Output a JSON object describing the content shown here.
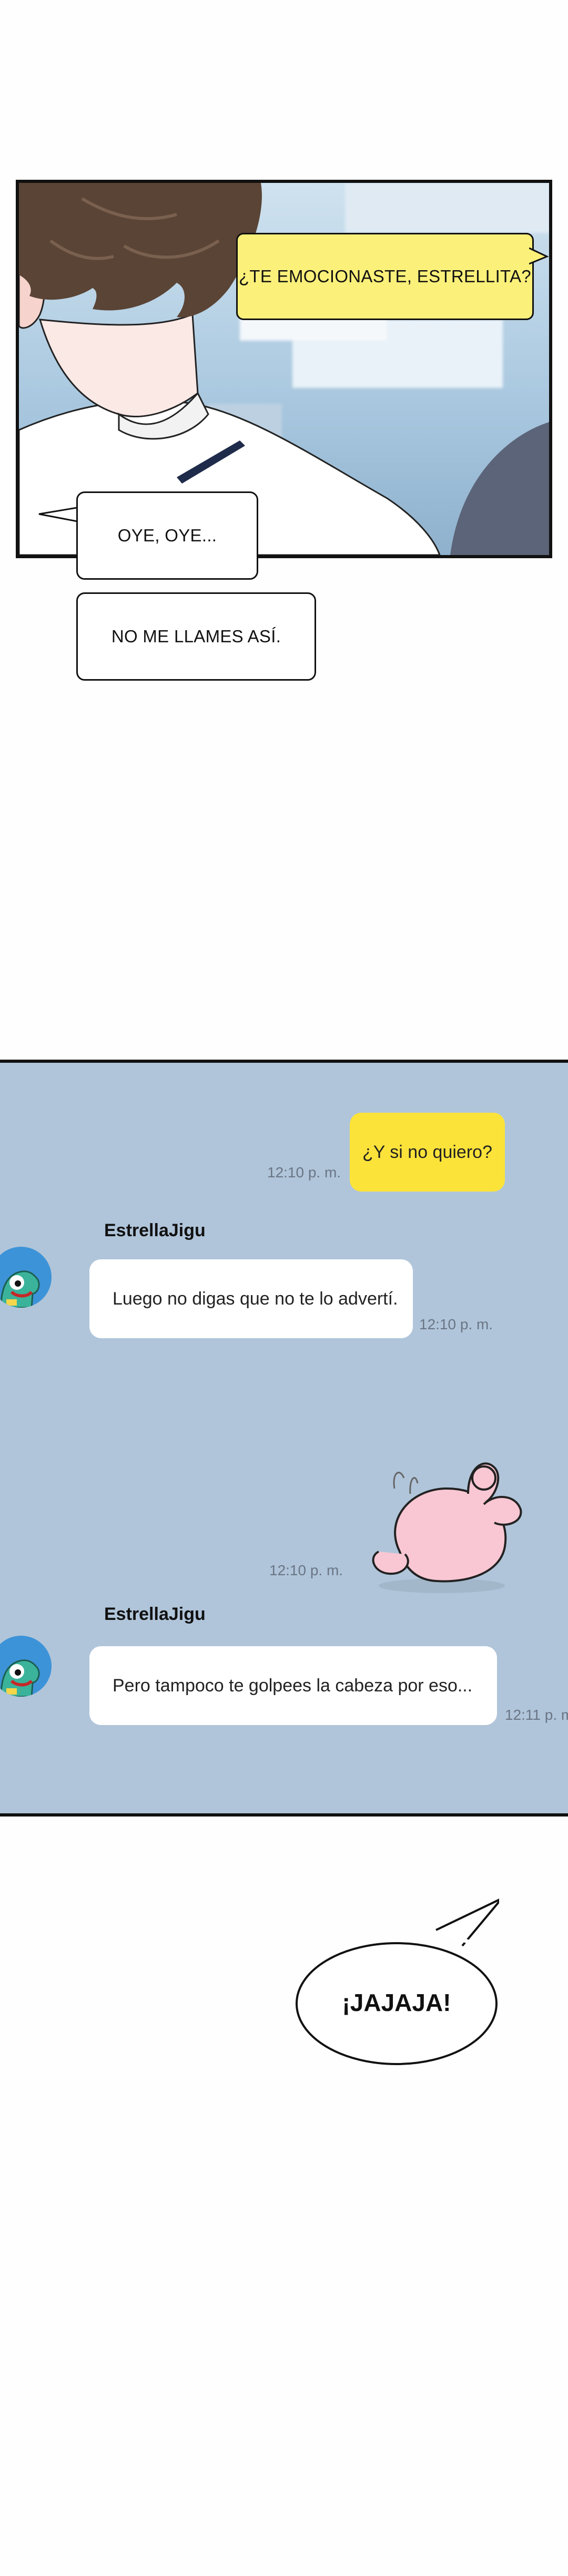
{
  "panel1": {
    "caption_yellow": "¿TE EMOCIONASTE, ESTRELLITA?",
    "caption_oye": "OYE, OYE...",
    "caption_llames": "NO ME LLAMES ASÍ."
  },
  "chat": {
    "messages": [
      {
        "from": "me",
        "text": "¿Y si no quiero?",
        "time": "12:10 p. m."
      },
      {
        "from": "other",
        "sender": "EstrellaJigu",
        "text": "Luego no digas que no te lo advertí.",
        "time": "12:10 p. m."
      },
      {
        "from": "me",
        "sticker": "pink-bunny-sticker",
        "time": "12:10 p. m."
      },
      {
        "from": "other",
        "sender": "EstrellaJigu",
        "text": "Pero tampoco te golpees la cabeza por eso...",
        "time": "12:11 p. m."
      }
    ]
  },
  "speech": {
    "laugh": "¡JAJAJA!"
  },
  "colors": {
    "chat_background": "#b0c5da",
    "my_bubble": "#fce33a",
    "their_bubble": "#ffffff",
    "yellow_caption": "#fbf07a",
    "avatar": "#3d93d8"
  }
}
